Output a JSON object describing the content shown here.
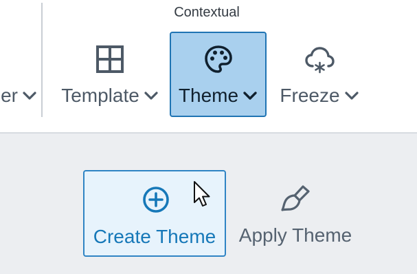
{
  "ribbon": {
    "group_label": "Contextual",
    "buttons": {
      "partial": {
        "label": "er",
        "icon": "chevron-down-icon"
      },
      "template": {
        "label": "Template",
        "icon": "grid-icon"
      },
      "theme": {
        "label": "Theme",
        "icon": "palette-icon",
        "active": true
      },
      "freeze": {
        "label": "Freeze",
        "icon": "cloud-snow-icon"
      }
    }
  },
  "theme_menu": {
    "create": {
      "label": "Create Theme",
      "icon": "plus-circle-icon"
    },
    "apply": {
      "label": "Apply Theme",
      "icon": "paintbrush-icon"
    }
  },
  "colors": {
    "active_fill": "#a9d0ee",
    "active_border": "#1f74b3",
    "accent_text": "#1678b8",
    "icon_gray": "#4d5966"
  }
}
